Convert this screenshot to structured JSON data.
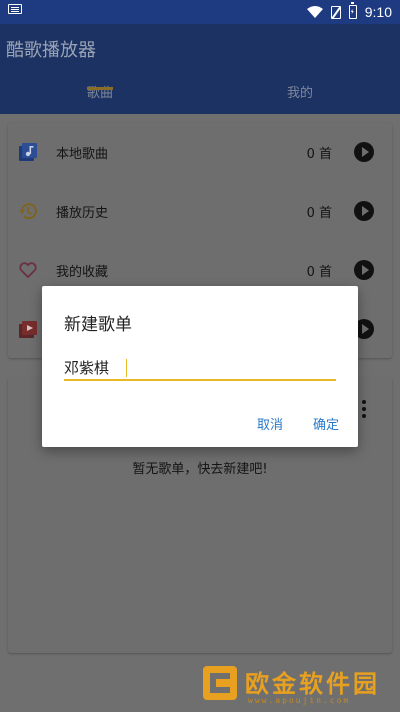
{
  "status_bar": {
    "time": "9:10"
  },
  "app": {
    "title": "酷歌播放器"
  },
  "tabs": [
    {
      "label": "歌曲"
    },
    {
      "label": "我的"
    }
  ],
  "library": [
    {
      "label": "本地歌曲",
      "count": "0 首",
      "icon": "music-library-icon"
    },
    {
      "label": "播放历史",
      "count": "0 首",
      "icon": "history-icon"
    },
    {
      "label": "我的收藏",
      "count": "0 首",
      "icon": "heart-icon"
    },
    {
      "label": "",
      "count": "",
      "icon": "video-icon"
    }
  ],
  "playlists": {
    "empty_text": "暂无歌单，快去新建吧!"
  },
  "dialog": {
    "title": "新建歌单",
    "input_value": "邓紫棋",
    "cancel_label": "取消",
    "ok_label": "确定"
  },
  "watermark": {
    "text": "欧金软件园",
    "url": "www.apoujin.com"
  },
  "colors": {
    "app_bar": "#1b3263",
    "accent": "#e9b825",
    "dialog_button": "#2979c9"
  }
}
